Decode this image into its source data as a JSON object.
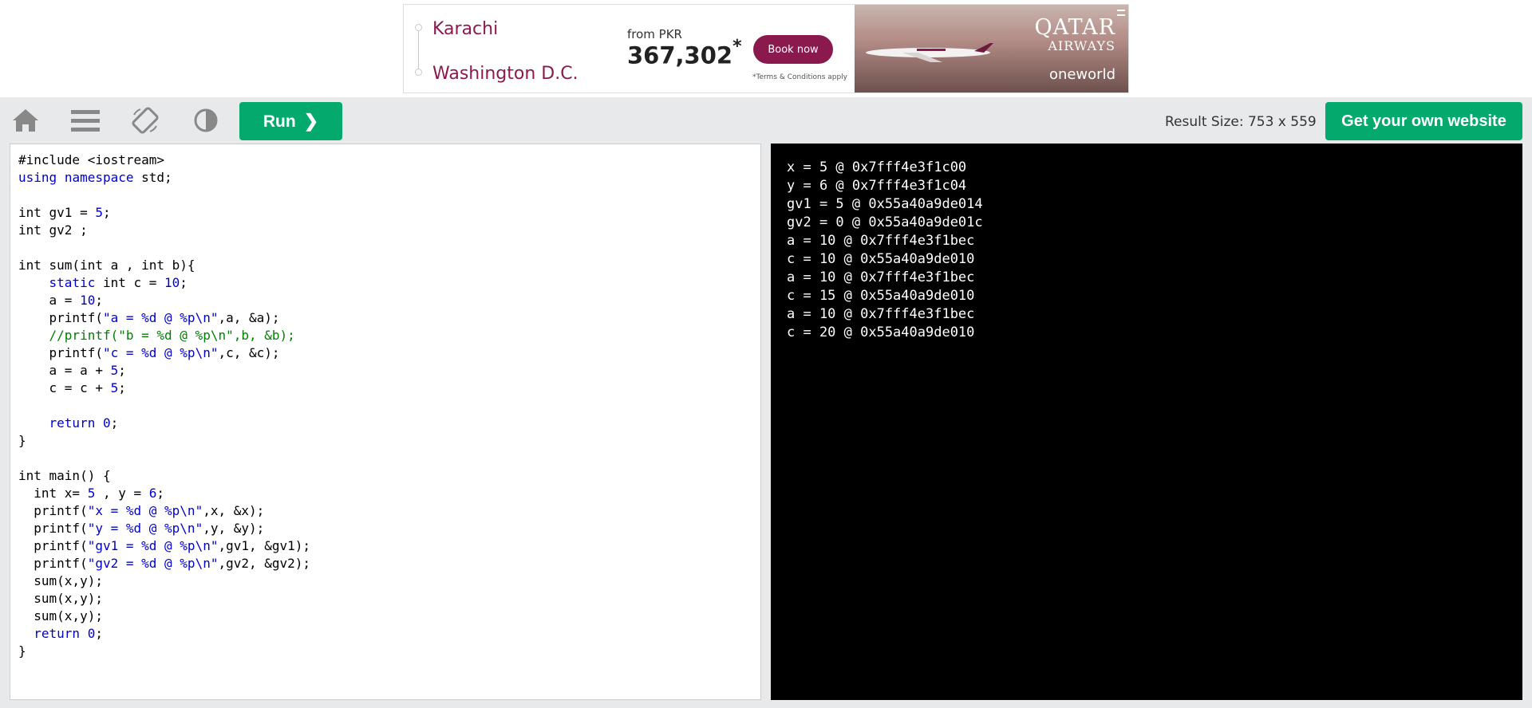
{
  "ad": {
    "origin": "Karachi",
    "destination": "Washington D.C.",
    "price_from": "from PKR",
    "price": "367,302",
    "price_mark": "*",
    "book_label": "Book now",
    "terms": "*Terms & Conditions apply",
    "brand_line1": "QATAR",
    "brand_line2": "AIRWAYS",
    "alliance": "oneworld",
    "brand_color": "#8a1a4e"
  },
  "toolbar": {
    "icons": [
      "home-icon",
      "menu-icon",
      "rotate-icon",
      "contrast-icon"
    ],
    "run_label": "Run",
    "run_chevron": "❯",
    "result_size": "Result Size: 753 x 559",
    "get_website_label": "Get your own website",
    "accent_color": "#04aa6d"
  },
  "code": {
    "lines": [
      [
        [
          "p",
          "#include <iostream>"
        ]
      ],
      [
        [
          "k",
          "using"
        ],
        [
          "p",
          " "
        ],
        [
          "k",
          "namespace"
        ],
        [
          "p",
          " std;"
        ]
      ],
      [],
      [
        [
          "p",
          "int gv1 = "
        ],
        [
          "n",
          "5"
        ],
        [
          "p",
          ";"
        ]
      ],
      [
        [
          "p",
          "int gv2 ;"
        ]
      ],
      [],
      [
        [
          "p",
          "int sum(int a , int b){"
        ]
      ],
      [
        [
          "p",
          "    "
        ],
        [
          "k",
          "static"
        ],
        [
          "p",
          " int c = "
        ],
        [
          "n",
          "10"
        ],
        [
          "p",
          ";"
        ]
      ],
      [
        [
          "p",
          "    a = "
        ],
        [
          "n",
          "10"
        ],
        [
          "p",
          ";"
        ]
      ],
      [
        [
          "p",
          "    printf("
        ],
        [
          "s",
          "\"a = %d @ %p\\n\""
        ],
        [
          "p",
          ",a, &a);"
        ]
      ],
      [
        [
          "p",
          "    "
        ],
        [
          "c",
          "//printf(\"b = %d @ %p\\n\",b, &b);"
        ]
      ],
      [
        [
          "p",
          "    printf("
        ],
        [
          "s",
          "\"c = %d @ %p\\n\""
        ],
        [
          "p",
          ",c, &c);"
        ]
      ],
      [
        [
          "p",
          "    a = a + "
        ],
        [
          "n",
          "5"
        ],
        [
          "p",
          ";"
        ]
      ],
      [
        [
          "p",
          "    c = c + "
        ],
        [
          "n",
          "5"
        ],
        [
          "p",
          ";"
        ]
      ],
      [],
      [
        [
          "p",
          "    "
        ],
        [
          "k",
          "return"
        ],
        [
          "p",
          " "
        ],
        [
          "n",
          "0"
        ],
        [
          "p",
          ";"
        ]
      ],
      [
        [
          "p",
          "}"
        ]
      ],
      [],
      [
        [
          "p",
          "int main() {"
        ]
      ],
      [
        [
          "p",
          "  int x= "
        ],
        [
          "n",
          "5"
        ],
        [
          "p",
          " , y = "
        ],
        [
          "n",
          "6"
        ],
        [
          "p",
          ";"
        ]
      ],
      [
        [
          "p",
          "  printf("
        ],
        [
          "s",
          "\"x = %d @ %p\\n\""
        ],
        [
          "p",
          ",x, &x);"
        ]
      ],
      [
        [
          "p",
          "  printf("
        ],
        [
          "s",
          "\"y = %d @ %p\\n\""
        ],
        [
          "p",
          ",y, &y);"
        ]
      ],
      [
        [
          "p",
          "  printf("
        ],
        [
          "s",
          "\"gv1 = %d @ %p\\n\""
        ],
        [
          "p",
          ",gv1, &gv1);"
        ]
      ],
      [
        [
          "p",
          "  printf("
        ],
        [
          "s",
          "\"gv2 = %d @ %p\\n\""
        ],
        [
          "p",
          ",gv2, &gv2);"
        ]
      ],
      [
        [
          "p",
          "  sum(x,y);"
        ]
      ],
      [
        [
          "p",
          "  sum(x,y);"
        ]
      ],
      [
        [
          "p",
          "  sum(x,y);"
        ]
      ],
      [
        [
          "p",
          "  "
        ],
        [
          "k",
          "return"
        ],
        [
          "p",
          " "
        ],
        [
          "n",
          "0"
        ],
        [
          "p",
          ";"
        ]
      ],
      [
        [
          "p",
          "}"
        ]
      ]
    ]
  },
  "output": {
    "lines": [
      "x = 5 @ 0x7fff4e3f1c00",
      "y = 6 @ 0x7fff4e3f1c04",
      "gv1 = 5 @ 0x55a40a9de014",
      "gv2 = 0 @ 0x55a40a9de01c",
      "a = 10 @ 0x7fff4e3f1bec",
      "c = 10 @ 0x55a40a9de010",
      "a = 10 @ 0x7fff4e3f1bec",
      "c = 15 @ 0x55a40a9de010",
      "a = 10 @ 0x7fff4e3f1bec",
      "c = 20 @ 0x55a40a9de010"
    ]
  }
}
